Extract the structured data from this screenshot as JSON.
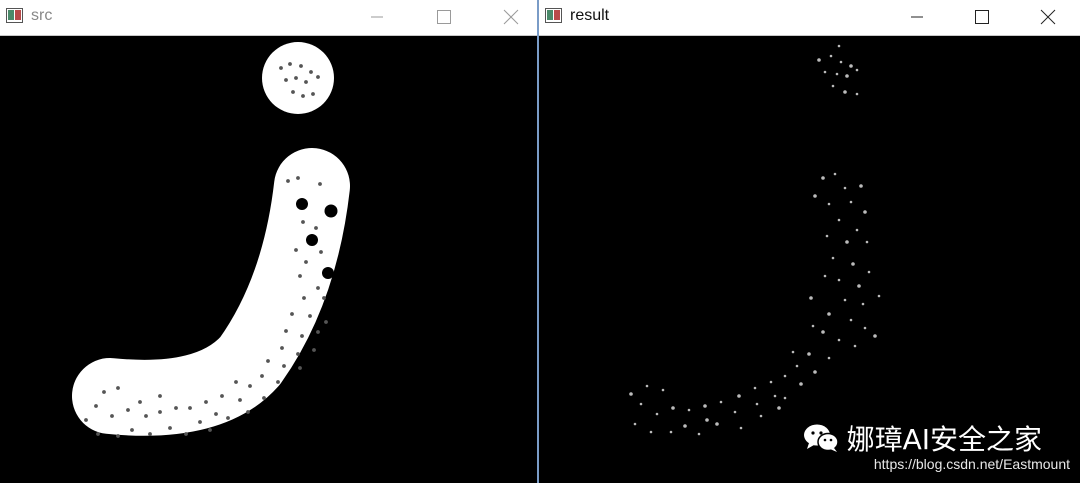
{
  "windows": {
    "src": {
      "title": "src"
    },
    "result": {
      "title": "result"
    }
  },
  "controls": {
    "minimize_icon": "minimize-icon",
    "maximize_icon": "maximize-icon",
    "close_icon": "close-icon"
  },
  "watermark": {
    "name": "娜璋AI安全之家",
    "url": "https://blog.csdn.net/Eastmount",
    "icon": "wechat-icon"
  },
  "colors": {
    "canvas": "#000000",
    "shape": "#ffffff",
    "divider": "#7a9cc7"
  }
}
